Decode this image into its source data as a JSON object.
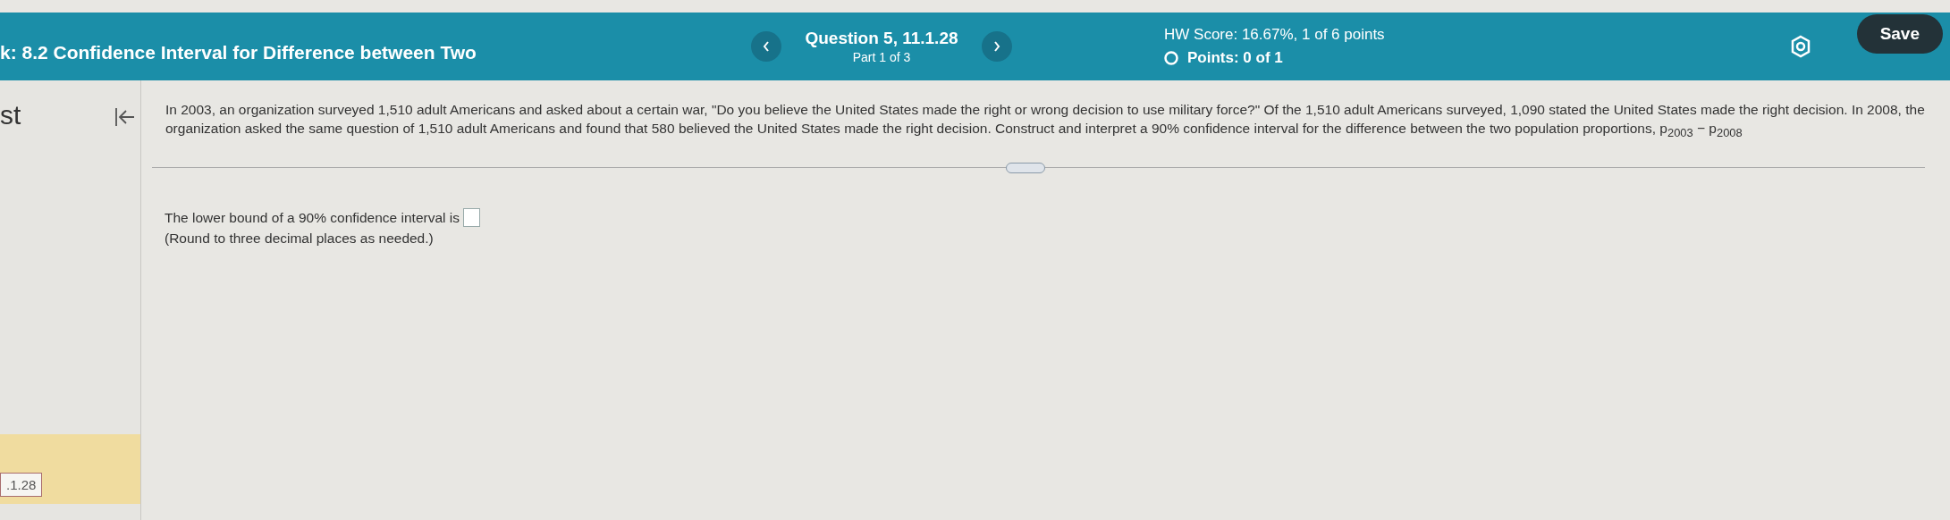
{
  "header": {
    "title": "k: 8.2 Confidence Interval for Difference between Two",
    "question": "Question 5, 11.1.28",
    "part": "Part 1 of 3",
    "hw_score": "HW Score: 16.67%, 1 of 6 points",
    "points": "Points: 0 of 1",
    "save": "Save"
  },
  "sidebar": {
    "heading": "st",
    "items": [
      {
        "label": ".1.28",
        "selected": true
      }
    ]
  },
  "question": {
    "text": "In 2003, an organization surveyed 1,510 adult Americans and asked about a certain war, \"Do you believe the United States made the right or wrong decision to use military force?\" Of the 1,510 adult Americans surveyed, 1,090 stated the United States made the right decision. In 2008, the organization asked the same question of 1,510 adult Americans and found that 580 believed the United States made the right decision. Construct and interpret a 90% confidence interval for the difference between the two population proportions, p$_{2003}$ − p$_{2008}$"
  },
  "answer": {
    "prompt": "The lower bound of a 90% confidence interval is",
    "hint": "(Round to three decimal places as needed.)"
  }
}
